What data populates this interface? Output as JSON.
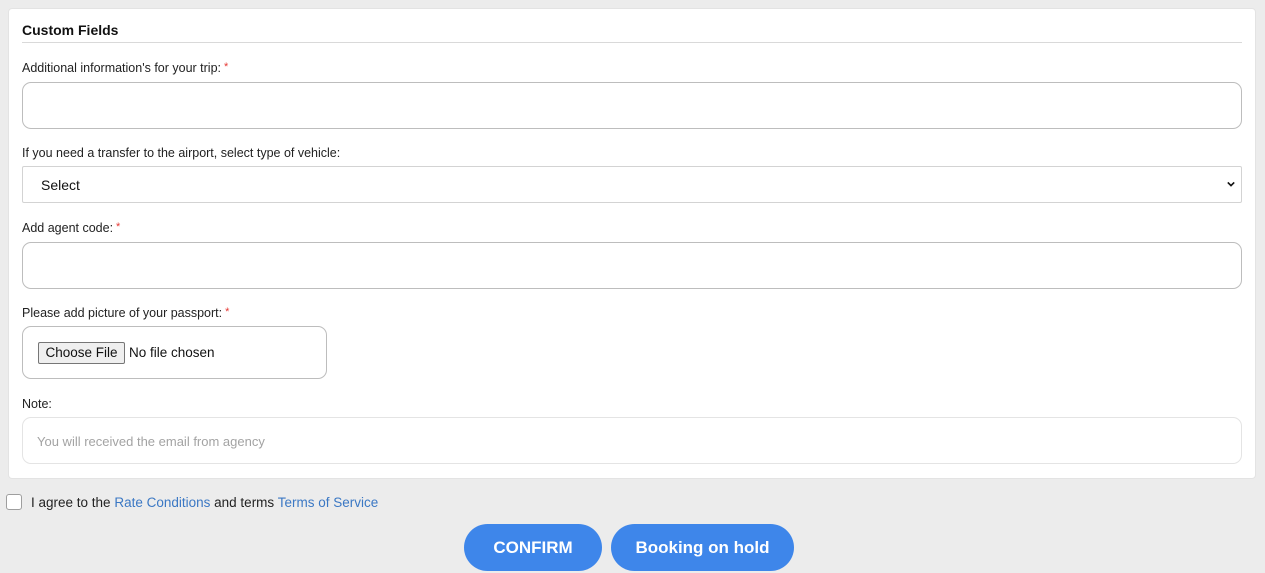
{
  "section": {
    "title": "Custom Fields"
  },
  "fields": {
    "additional_info": {
      "label": "Additional information's for your trip:",
      "required_mark": "*",
      "value": ""
    },
    "vehicle": {
      "label": "If you need a transfer to the airport, select type of vehicle:",
      "selected": "Select"
    },
    "agent_code": {
      "label": "Add agent code:",
      "required_mark": "*",
      "value": ""
    },
    "passport": {
      "label": "Please add picture of your passport:",
      "required_mark": "*",
      "button_label": "Choose File",
      "status": "No file chosen"
    },
    "note": {
      "label": "Note:",
      "placeholder": "You will received the email from agency"
    }
  },
  "agreement": {
    "prefix": "I agree to the",
    "rate_link": "Rate Conditions",
    "middle": "and terms",
    "tos_link": "Terms of Service",
    "checked": false
  },
  "actions": {
    "confirm_label": "CONFIRM",
    "hold_label": "Booking on hold"
  },
  "colors": {
    "accent": "#3e86ea",
    "link": "#3b78c4",
    "required": "#e53935"
  },
  "icons": {
    "select_arrow": "chevron-down-icon"
  }
}
